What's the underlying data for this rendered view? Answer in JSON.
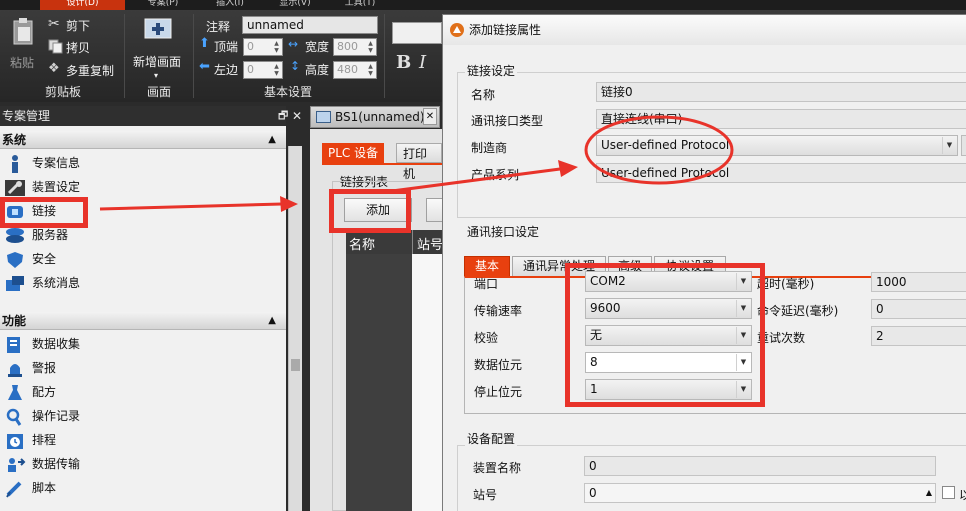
{
  "ribbon": {
    "tabs": [
      "设计(D)",
      "专案(P)",
      "插入(I)",
      "显示(V)",
      "工具(T)"
    ],
    "clipboard": {
      "paste": "粘贴",
      "cut": "剪下",
      "copy": "拷贝",
      "multi_copy": "多重复制",
      "group": "剪贴板"
    },
    "screen": {
      "new_screen": "新增画面",
      "group": "画面"
    },
    "basic": {
      "comment_label": "注释",
      "comment_value": "unnamed",
      "top_label": "顶端",
      "top_value": "0",
      "left_label": "左边",
      "left_value": "0",
      "width_label": "宽度",
      "width_value": "800",
      "height_label": "高度",
      "height_value": "480",
      "group": "基本设置"
    }
  },
  "left_panel": {
    "title": "专案管理",
    "system_section": "系统",
    "system_items": [
      "专案信息",
      "装置设定",
      "链接",
      "服务器",
      "安全",
      "系统消息"
    ],
    "function_section": "功能",
    "function_items": [
      "数据收集",
      "警报",
      "配方",
      "操作记录",
      "排程",
      "数据传输",
      "脚本"
    ]
  },
  "document": {
    "tab_title": "BS1(unnamed)",
    "tabs": [
      "PLC 设备",
      "打印机"
    ],
    "link_list": "链接列表",
    "add_button": "添加",
    "columns": [
      "名称",
      "站号"
    ]
  },
  "dialog": {
    "title": "添加链接属性",
    "link_settings": {
      "group": "链接设定",
      "name_label": "名称",
      "name_value": "链接0",
      "interface_label": "通讯接口类型",
      "interface_value": "直接连线(串口)",
      "manufacturer_label": "制造商",
      "manufacturer_value": "User-defined Protocol",
      "series_label": "产品系列",
      "series_value": "User-defined Protocol"
    },
    "comm_settings": {
      "group": "通讯接口设定",
      "tabs": [
        "基本",
        "通讯异常处理",
        "高级",
        "协议设置"
      ],
      "port_label": "端口",
      "port_value": "COM2",
      "baud_label": "传输速率",
      "baud_value": "9600",
      "parity_label": "校验",
      "parity_value": "无",
      "databits_label": "数据位元",
      "databits_value": "8",
      "stopbits_label": "停止位元",
      "stopbits_value": "1",
      "timeout_label": "超时(毫秒)",
      "timeout_value": "1000",
      "delay_label": "命令延迟(毫秒)",
      "delay_value": "0",
      "retry_label": "重试次数",
      "retry_value": "2"
    },
    "device_config": {
      "group": "设备配置",
      "device_name_label": "装置名称",
      "device_name_value": "0",
      "station_label": "站号",
      "station_value": "0",
      "checkbox_label": "以"
    }
  },
  "colors": {
    "annotation_red": "#e8332a",
    "active_tab": "#e8400f",
    "ribbon_active": "#c8330e"
  }
}
